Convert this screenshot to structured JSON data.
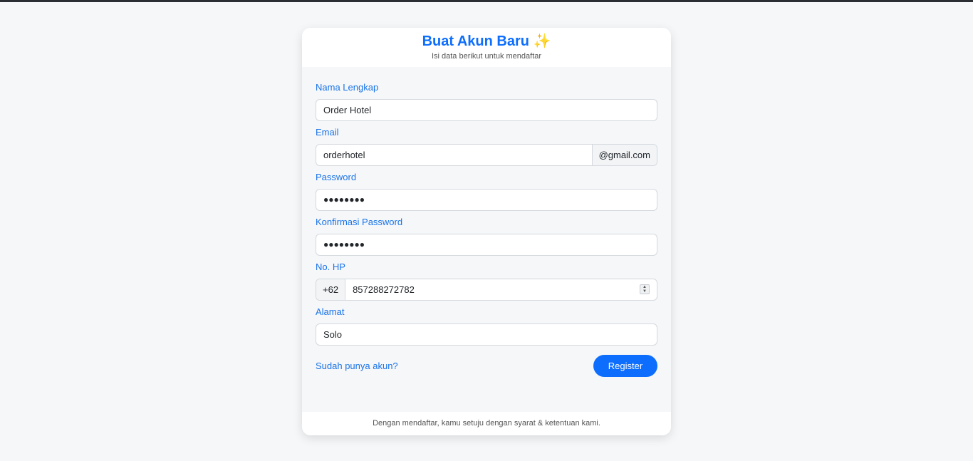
{
  "header": {
    "title": "Buat Akun Baru",
    "title_emoji": "✨",
    "subtitle": "Isi data berikut untuk mendaftar"
  },
  "form": {
    "full_name": {
      "label": "Nama Lengkap",
      "value": "Order Hotel"
    },
    "email": {
      "label": "Email",
      "value": "orderhotel",
      "suffix": "@gmail.com"
    },
    "password": {
      "label": "Password",
      "value": "●●●●●●●●"
    },
    "confirm_password": {
      "label": "Konfirmasi Password",
      "value": "●●●●●●●●"
    },
    "phone": {
      "label": "No. HP",
      "prefix": "+62",
      "value": "857288272782"
    },
    "address": {
      "label": "Alamat",
      "value": "Solo"
    }
  },
  "actions": {
    "login_link": "Sudah punya akun?",
    "register_label": "Register"
  },
  "footer": {
    "terms": "Dengan mendaftar, kamu setuju dengan syarat & ketentuan kami."
  },
  "colors": {
    "accent": "#0d6efd",
    "label": "#1a73e8",
    "background": "#f5f7f9"
  }
}
